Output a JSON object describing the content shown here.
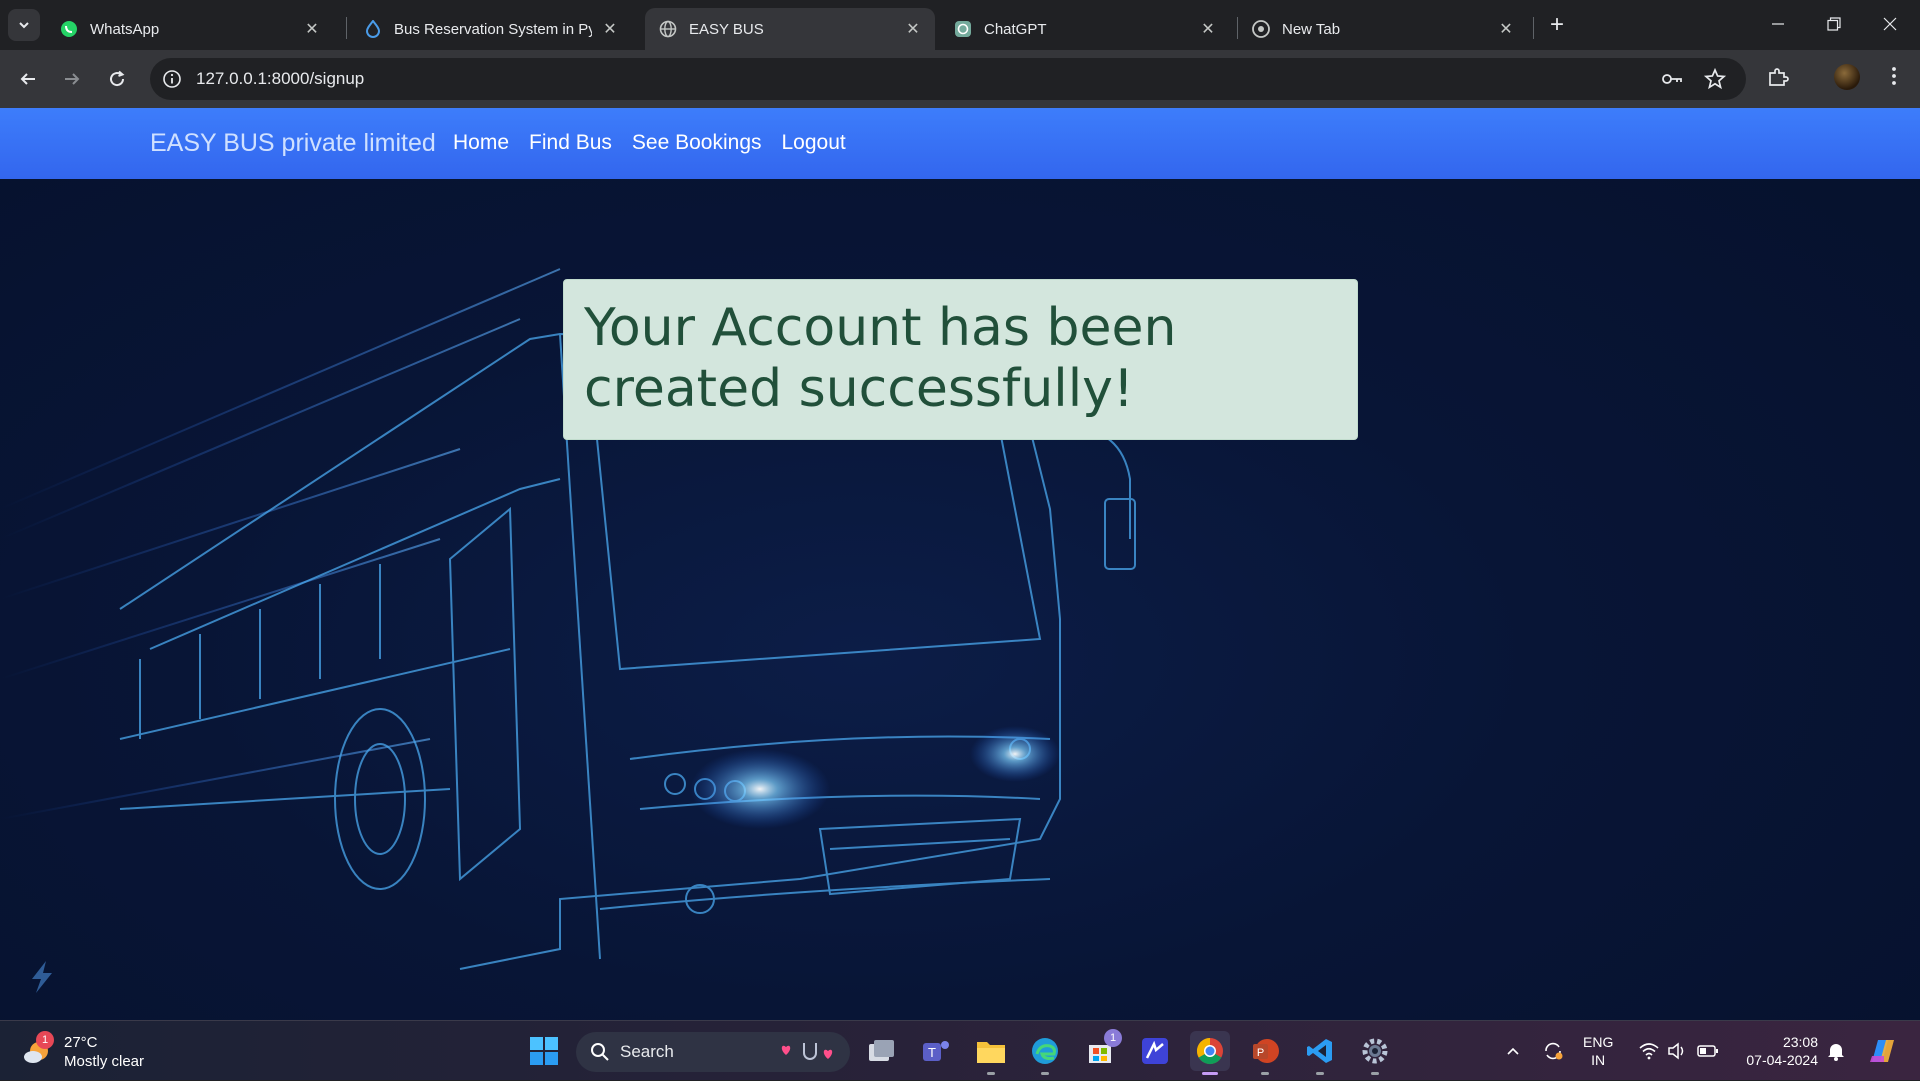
{
  "browser": {
    "tabs": [
      {
        "title": "WhatsApp",
        "icon": "whatsapp-icon",
        "active": false
      },
      {
        "title": "Bus Reservation System in Pytho",
        "icon": "drupal-icon",
        "active": false
      },
      {
        "title": "EASY BUS",
        "icon": "globe-icon",
        "active": true
      },
      {
        "title": "ChatGPT",
        "icon": "chatgpt-icon",
        "active": false
      },
      {
        "title": "New Tab",
        "icon": "chrome-icon",
        "active": false
      }
    ],
    "url": "127.0.0.1:8000/signup"
  },
  "site": {
    "brand": "EASY BUS private limited",
    "nav": [
      "Home",
      "Find Bus",
      "See Bookings",
      "Logout"
    ],
    "alert_message": "Your Account has been created successfully!"
  },
  "taskbar": {
    "weather_temp": "27°C",
    "weather_desc": "Mostly clear",
    "weather_badge": "1",
    "search_placeholder": "Search",
    "store_badge": "1",
    "lang_line1": "ENG",
    "lang_line2": "IN",
    "time": "23:08",
    "date": "07-04-2024"
  },
  "colors": {
    "navbar": "#3d7dfb",
    "alert_bg": "#d3e6dd",
    "alert_text": "#21503a",
    "page_bg": "#081536"
  }
}
